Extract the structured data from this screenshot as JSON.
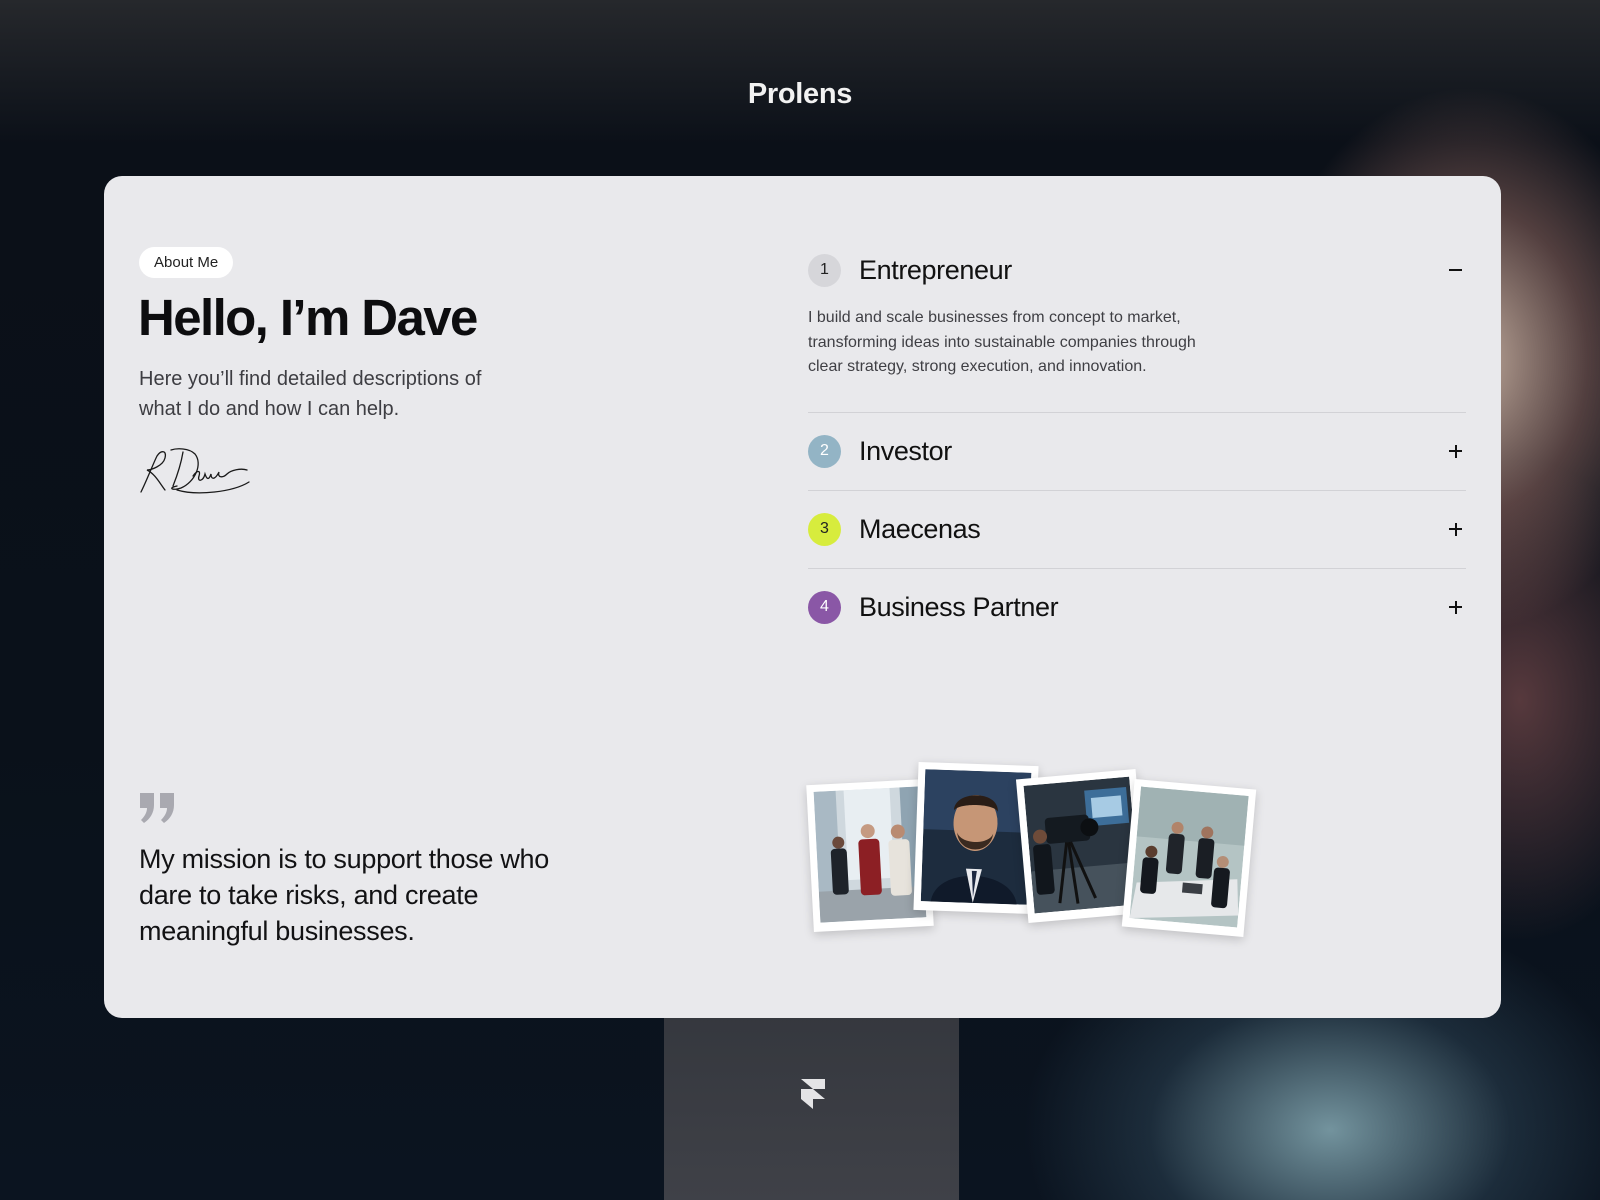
{
  "site": {
    "title": "Prolens"
  },
  "about": {
    "pill": "About Me",
    "heading": "Hello, I’m Dave",
    "intro": "Here you’ll find detailed descriptions of what I do and how I can help.",
    "mission": "My mission is to support those who dare to take risks, and create meaningful businesses."
  },
  "roles": [
    {
      "number": "1",
      "title": "Entrepreneur",
      "expanded": true,
      "badge_color": "#d6d6da",
      "badge_text_color": "#222222",
      "description": "I build and scale businesses from concept to market, transforming ideas into sustainable companies through clear strategy, strong execution, and innovation."
    },
    {
      "number": "2",
      "title": "Investor",
      "expanded": false,
      "badge_color": "#93b4c5",
      "badge_text_color": "#ffffff"
    },
    {
      "number": "3",
      "title": "Maecenas",
      "expanded": false,
      "badge_color": "#d7ec3d",
      "badge_text_color": "#222222"
    },
    {
      "number": "4",
      "title": "Business Partner",
      "expanded": false,
      "badge_color": "#8a57a6",
      "badge_text_color": "#ffffff"
    }
  ],
  "gallery": [
    {
      "name": "team-meeting-office-photo"
    },
    {
      "name": "portrait-photo"
    },
    {
      "name": "camera-studio-photo"
    },
    {
      "name": "boardroom-photo"
    }
  ],
  "icons": {
    "signature": "signature-icon",
    "quote": "quote-icon",
    "framer": "framer-logo-icon"
  }
}
